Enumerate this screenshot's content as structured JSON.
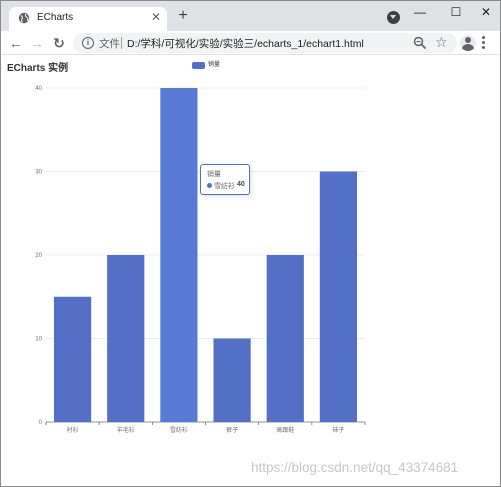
{
  "browser": {
    "tab_title": "ECharts",
    "tab_close": "✕",
    "new_tab": "+",
    "window_controls": {
      "minimize": "—",
      "maximize": "☐",
      "close": "✕"
    },
    "nav": {
      "back": "←",
      "forward": "→",
      "reload": "↻"
    },
    "omnibox": {
      "info_glyph": "i",
      "scheme_label": "文件",
      "url": "D:/学科/可视化/实验/实验三/echarts_1/echart1.html"
    },
    "star_glyph": "☆",
    "icons": [
      "globe-icon",
      "profile-menu-icon",
      "info-icon",
      "zoom-icon",
      "bookmark-star-icon",
      "avatar",
      "menu-icon"
    ]
  },
  "page": {
    "title": "ECharts 实例",
    "watermark": "https://blog.csdn.net/qq_43374681"
  },
  "chart_data": {
    "type": "bar",
    "title": "ECharts 实例",
    "legend": [
      "销量"
    ],
    "legend_position": "top-center",
    "categories": [
      "衬衫",
      "羊毛衫",
      "雪纺衫",
      "裤子",
      "高跟鞋",
      "袜子"
    ],
    "series": [
      {
        "name": "销量",
        "values": [
          15,
          20,
          40,
          10,
          20,
          30
        ]
      }
    ],
    "ylim": [
      0,
      40
    ],
    "yticks": [
      0,
      10,
      20,
      30,
      40
    ],
    "grid": true,
    "bar_color": "#5470c6",
    "highlight_color": "#5a7bd5",
    "highlight_index": 2,
    "tooltip": {
      "title": "销量",
      "name": "雪纺衫",
      "value": 40
    }
  }
}
